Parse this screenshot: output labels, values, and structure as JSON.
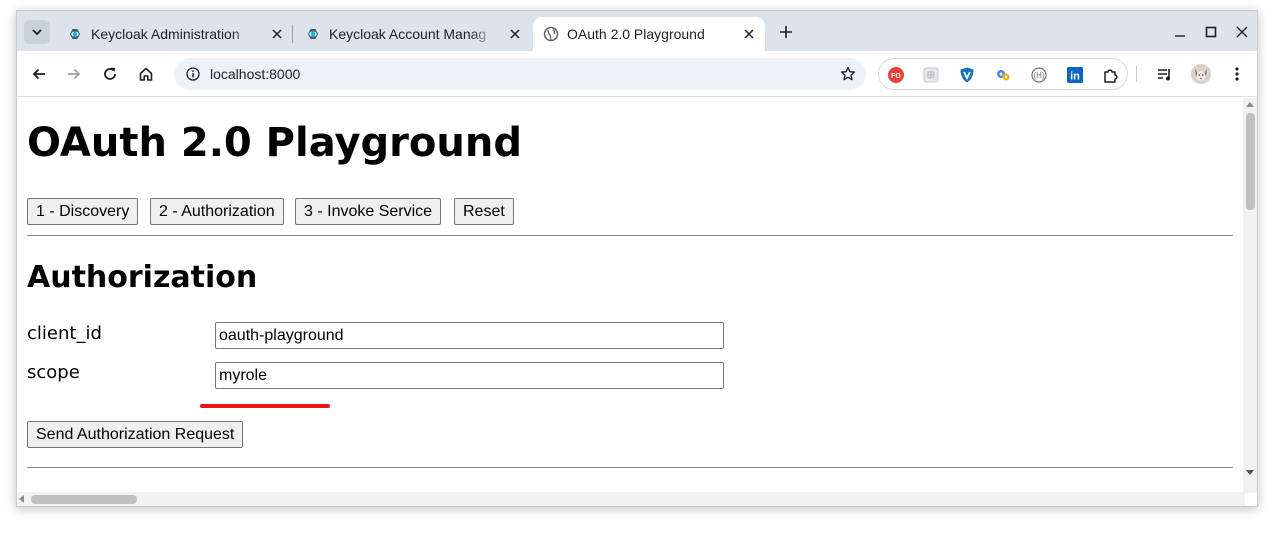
{
  "browser": {
    "tabs": [
      {
        "title": "Keycloak Administration",
        "icon": "keycloak-icon",
        "active": false
      },
      {
        "title": "Keycloak Account Manag",
        "icon": "keycloak-icon",
        "active": false
      },
      {
        "title": "OAuth 2.0 Playground",
        "icon": "globe-icon",
        "active": true
      }
    ],
    "url": "localhost:8000",
    "extensions": [
      "fo-extension-icon",
      "grid-extension-icon",
      "shield-extension-icon",
      "gear-extension-icon",
      "h-extension-icon",
      "linkedin-icon",
      "puzzle-icon"
    ],
    "linkedin_label": "in",
    "fo_label": "FO",
    "h_label": "(H)"
  },
  "page": {
    "title": "OAuth 2.0 Playground",
    "nav_buttons": [
      "1 - Discovery",
      "2 - Authorization",
      "3 - Invoke Service",
      "Reset"
    ],
    "section_title": "Authorization",
    "fields": [
      {
        "label": "client_id",
        "value": "oauth-playground"
      },
      {
        "label": "scope",
        "value": "myrole"
      }
    ],
    "submit_label": "Send Authorization Request",
    "annotation_color": "#e8121a"
  }
}
